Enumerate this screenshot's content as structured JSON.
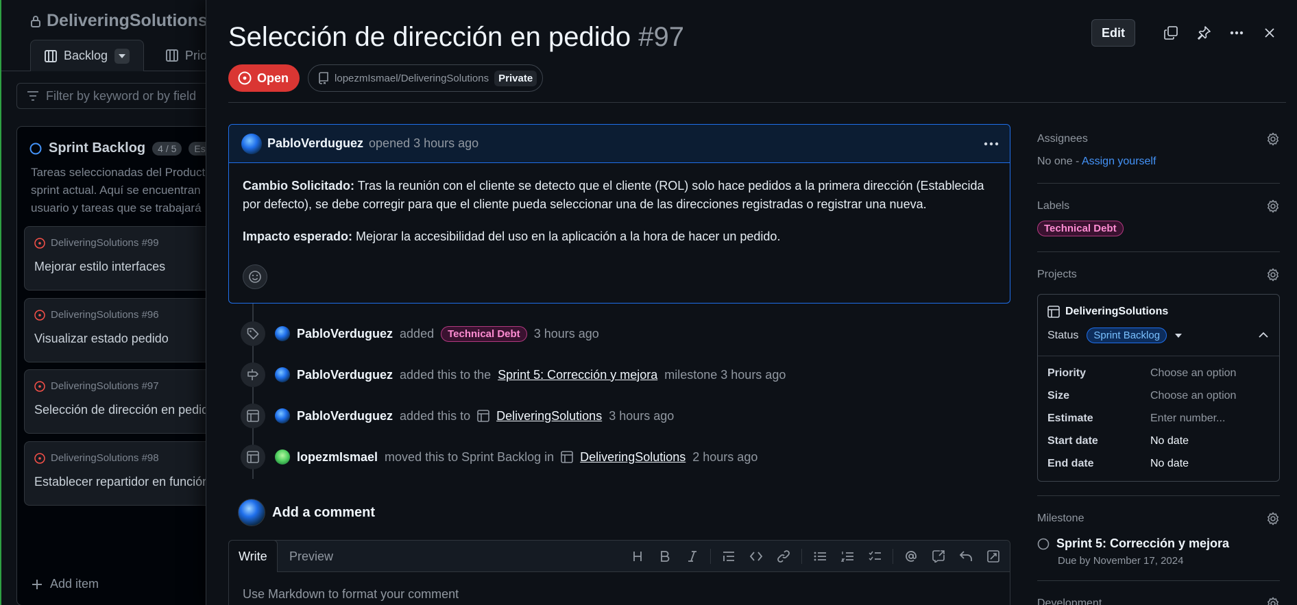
{
  "board": {
    "project_title": "DeliveringSolutions",
    "view_tab_active": "Backlog",
    "view_tab_2": "Prior",
    "filter_placeholder": "Filter by keyword or by field",
    "column": {
      "name": "Sprint Backlog",
      "count": "4 / 5",
      "estimate_tag": "Est",
      "description_lines": [
        "Tareas seleccionadas del Product",
        "sprint actual. Aquí se encuentran",
        "usuario y tareas que se trabajará"
      ]
    },
    "cards": [
      {
        "ref": "DeliveringSolutions #99",
        "title": "Mejorar estilo interfaces"
      },
      {
        "ref": "DeliveringSolutions #96",
        "title": "Visualizar estado pedido"
      },
      {
        "ref": "DeliveringSolutions #97",
        "title": "Selección de dirección en pedido"
      },
      {
        "ref": "DeliveringSolutions #98",
        "title": "Establecer repartidor en función"
      }
    ],
    "add_item_label": "Add item"
  },
  "issue": {
    "title": "Selección de dirección en pedido",
    "number": "#97",
    "edit_label": "Edit",
    "state": "Open",
    "repo": "lopezmIsmael/DeliveringSolutions",
    "visibility": "Private"
  },
  "comment": {
    "author": "PabloVerduguez",
    "meta": "opened 3 hours ago",
    "p1_label": "Cambio Solicitado:",
    "p1_text": " Tras la reunión con el cliente se detecto que el cliente (ROL) solo hace pedidos a la primera dirección (Establecida por defecto), se debe corregir para que el cliente pueda seleccionar una de las direcciones registradas o registrar una nueva.",
    "p2_label": "Impacto esperado:",
    "p2_text": " Mejorar la accesibilidad del uso en la aplicación a la hora de hacer un pedido."
  },
  "timeline": [
    {
      "actor": "PabloVerduguez",
      "pre": "added",
      "label": "Technical Debt",
      "post": "3 hours ago"
    },
    {
      "actor": "PabloVerduguez",
      "pre": "added this to the",
      "link": "Sprint 5: Corrección y mejora",
      "post": "milestone 3 hours ago"
    },
    {
      "actor": "PabloVerduguez",
      "pre": "added this to",
      "link": "DeliveringSolutions",
      "post": "3 hours ago"
    },
    {
      "actor": "lopezmIsmael",
      "pre": "moved this to Sprint Backlog in",
      "link": "DeliveringSolutions",
      "post": "2 hours ago"
    }
  ],
  "composer": {
    "heading": "Add a comment",
    "tab_write": "Write",
    "tab_preview": "Preview",
    "placeholder": "Use Markdown to format your comment"
  },
  "sidebar": {
    "assignees": {
      "heading": "Assignees",
      "none": "No one - ",
      "assign_link": "Assign yourself"
    },
    "labels": {
      "heading": "Labels",
      "items": [
        "Technical Debt"
      ]
    },
    "projects": {
      "heading": "Projects",
      "project_name": "DeliveringSolutions",
      "status_label": "Status",
      "status_value": "Sprint Backlog",
      "fields": [
        {
          "name": "Priority",
          "value": "Choose an option"
        },
        {
          "name": "Size",
          "value": "Choose an option"
        },
        {
          "name": "Estimate",
          "value": "Enter number..."
        },
        {
          "name": "Start date",
          "value": "No date"
        },
        {
          "name": "End date",
          "value": "No date"
        }
      ]
    },
    "milestone": {
      "heading": "Milestone",
      "name": "Sprint 5: Corrección y mejora",
      "due": "Due by November 17, 2024"
    },
    "development": {
      "heading": "Development"
    }
  },
  "colors": {
    "open": "#da3633",
    "accent": "#4493f8",
    "label_pink": "#ff8dd3",
    "border_focus": "#1f6feb"
  }
}
